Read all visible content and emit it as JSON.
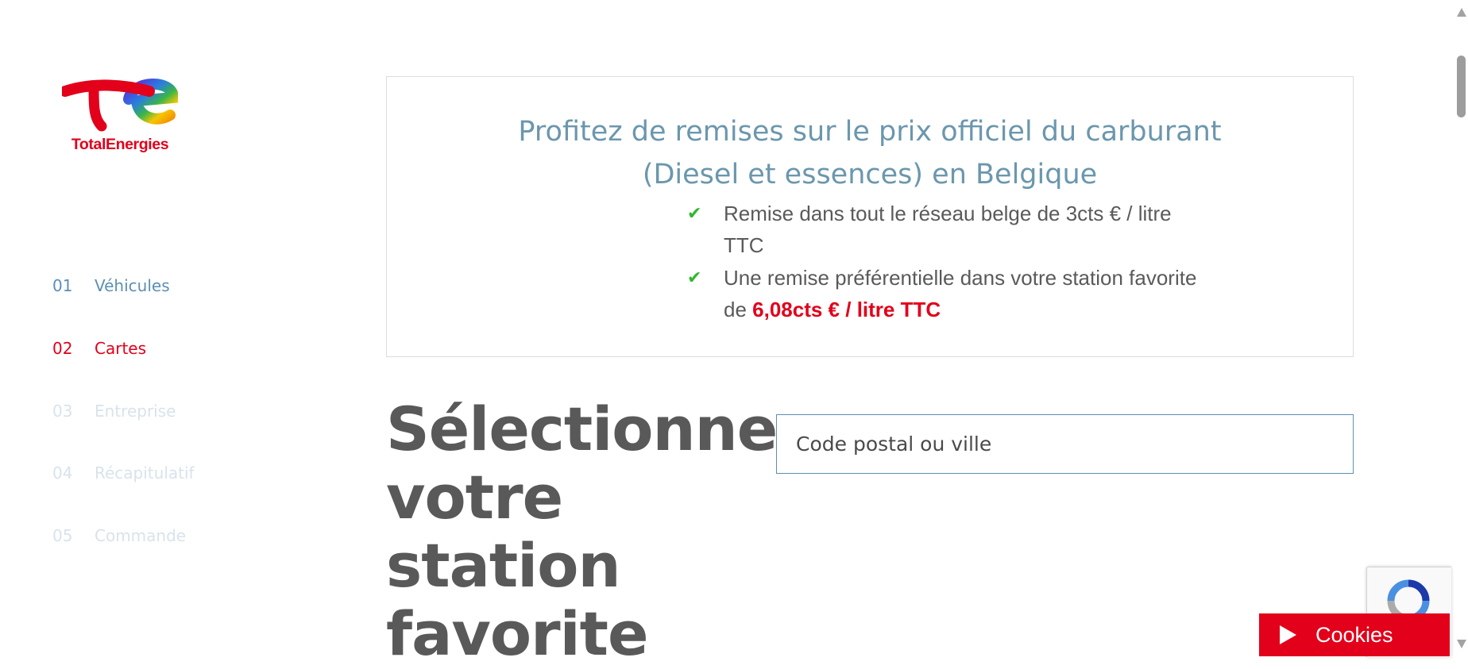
{
  "logo": {
    "text": "TotalEnergies"
  },
  "steps": [
    {
      "num": "01",
      "label": "Véhicules",
      "state": "done"
    },
    {
      "num": "02",
      "label": "Cartes",
      "state": "active"
    },
    {
      "num": "03",
      "label": "Entreprise",
      "state": "todo"
    },
    {
      "num": "04",
      "label": "Récapitulatif",
      "state": "todo"
    },
    {
      "num": "05",
      "label": "Commande",
      "state": "todo"
    }
  ],
  "promo": {
    "title_line1": "Profitez de remises sur le prix officiel du carburant",
    "title_line2": "(Diesel et essences) en Belgique",
    "benefit1": "Remise dans tout le réseau belge de 3cts € / litre TTC",
    "benefit2_prefix": "Une remise préférentielle dans votre station favorite de ",
    "benefit2_highlight": "6,08cts € / litre TTC"
  },
  "headline": "Sélectionnez votre station favorite",
  "search": {
    "placeholder": "Code postal ou ville"
  },
  "cookies": {
    "label": "Cookies"
  },
  "colors": {
    "brand_red": "#e2001a",
    "step_done": "#5c8fb5",
    "step_todo": "#d8e3ec",
    "promo_title": "#6b97ad",
    "check_green": "#2fb82f"
  }
}
